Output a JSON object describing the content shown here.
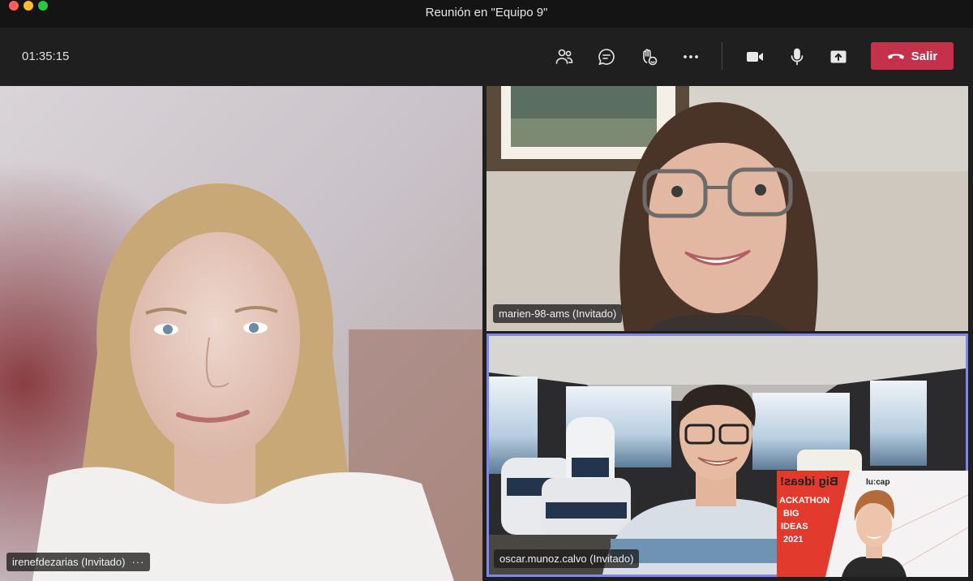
{
  "window": {
    "title": "Reunión en \"Equipo 9\""
  },
  "toolbar": {
    "timer": "01:35:15",
    "icons": [
      "participants-icon",
      "chat-icon",
      "reactions-icon",
      "more-options-icon",
      "camera-icon",
      "microphone-icon",
      "share-screen-icon"
    ],
    "leave_label": "Salir",
    "leave_color": "#c4314b"
  },
  "participants": [
    {
      "name": "irenefdezarias (Invitado)",
      "more": "···"
    },
    {
      "name": "marien-98-ams (Invitado)"
    },
    {
      "name": "oscar.munoz.calvo (Invitado)",
      "active_speaker": true
    }
  ],
  "self_view": {
    "background_texts": [
      "Big ideas!",
      "lu:cap",
      "ACKATHON",
      "BIG",
      "IDEAS",
      "2021"
    ]
  },
  "colors": {
    "active_border": "#7f85f5",
    "toolbar_bg": "#1f1f1f"
  }
}
